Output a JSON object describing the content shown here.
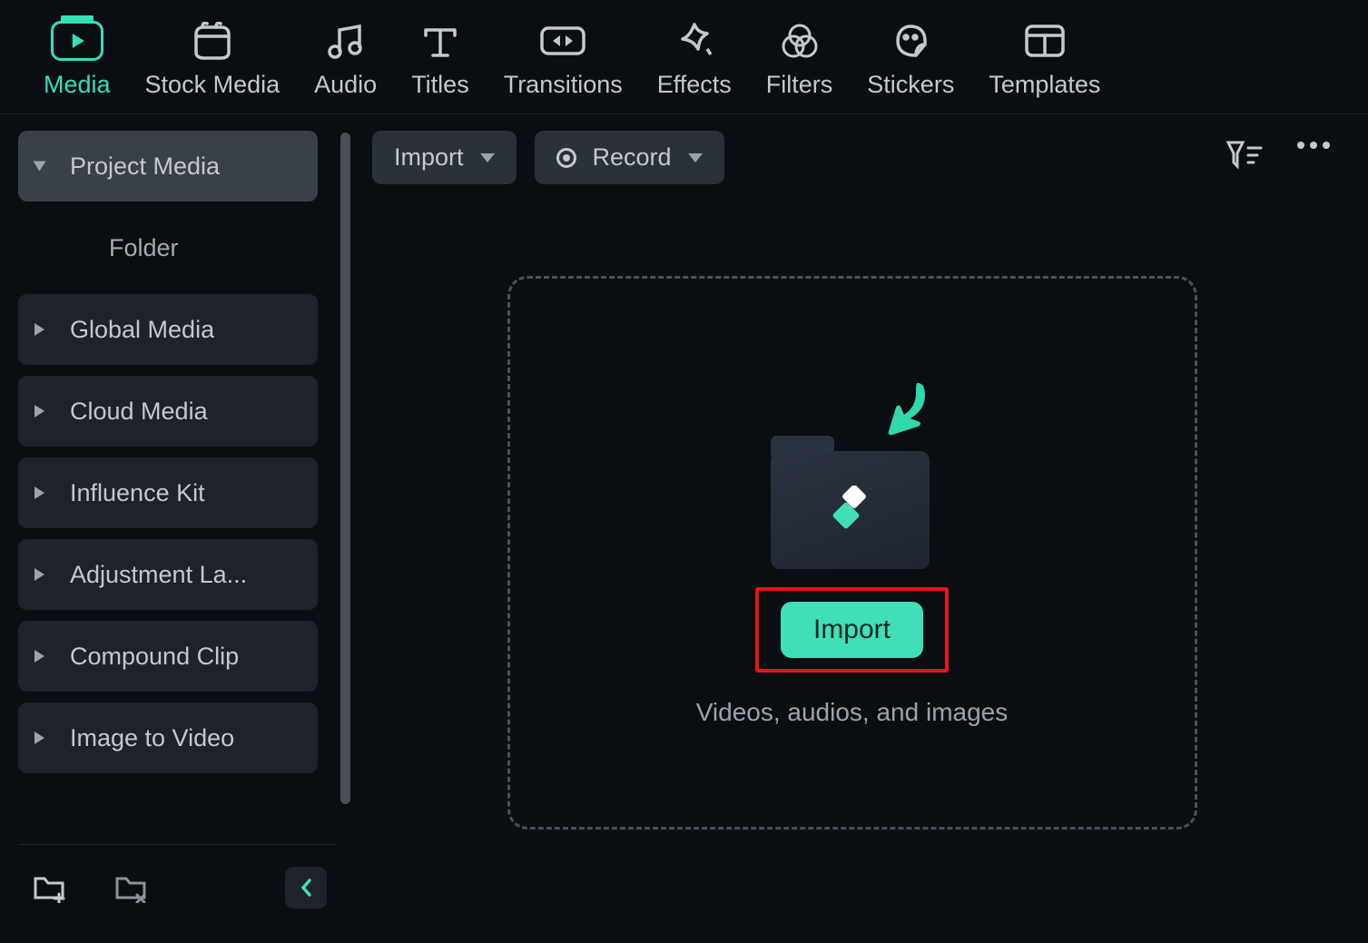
{
  "nav": [
    {
      "label": "Media"
    },
    {
      "label": "Stock Media"
    },
    {
      "label": "Audio"
    },
    {
      "label": "Titles"
    },
    {
      "label": "Transitions"
    },
    {
      "label": "Effects"
    },
    {
      "label": "Filters"
    },
    {
      "label": "Stickers"
    },
    {
      "label": "Templates"
    }
  ],
  "sidebar": {
    "items": [
      {
        "label": "Project Media"
      },
      {
        "label": "Folder"
      },
      {
        "label": "Global Media"
      },
      {
        "label": "Cloud Media"
      },
      {
        "label": "Influence Kit"
      },
      {
        "label": "Adjustment La..."
      },
      {
        "label": "Compound Clip"
      },
      {
        "label": "Image to Video"
      }
    ]
  },
  "toolbar": {
    "import_label": "Import",
    "record_label": "Record"
  },
  "dropzone": {
    "button_label": "Import",
    "caption": "Videos, audios, and images"
  },
  "colors": {
    "accent": "#34e0b8",
    "highlight_border": "#e81515"
  }
}
